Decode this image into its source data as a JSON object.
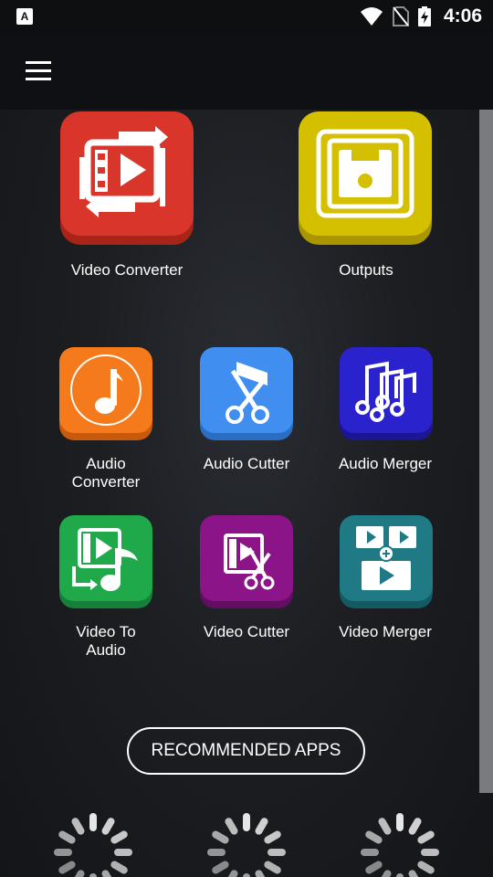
{
  "status_bar": {
    "app_badge": "A",
    "time": "4:06",
    "icons": [
      "wifi-icon",
      "no-sim-icon",
      "battery-charging-icon"
    ]
  },
  "app_bar": {
    "menu_icon": "hamburger-menu-icon"
  },
  "tiles": {
    "video_converter": {
      "label": "Video Converter",
      "color": "#d9352b",
      "icon": "video-convert-icon"
    },
    "outputs": {
      "label": "Outputs",
      "color": "#d4bf00",
      "icon": "floppy-disk-icon"
    },
    "audio_converter": {
      "label": "Audio\nConverter",
      "color": "#f47a1c",
      "icon": "music-note-icon"
    },
    "audio_cutter": {
      "label": "Audio Cutter",
      "color": "#3f8ef0",
      "icon": "scissors-music-icon"
    },
    "audio_merger": {
      "label": "Audio Merger",
      "color": "#2a22cc",
      "icon": "music-notes-icon"
    },
    "video_to_audio": {
      "label": "Video To\nAudio",
      "color": "#1fa94a",
      "icon": "video-to-music-icon"
    },
    "video_cutter": {
      "label": "Video Cutter",
      "color": "#8a1488",
      "icon": "film-scissors-icon"
    },
    "video_merger": {
      "label": "Video Merger",
      "color": "#1f7a86",
      "icon": "video-merge-icon"
    }
  },
  "recommended_button": {
    "label": "RECOMMENDED APPS"
  },
  "loading_spinners": 3
}
